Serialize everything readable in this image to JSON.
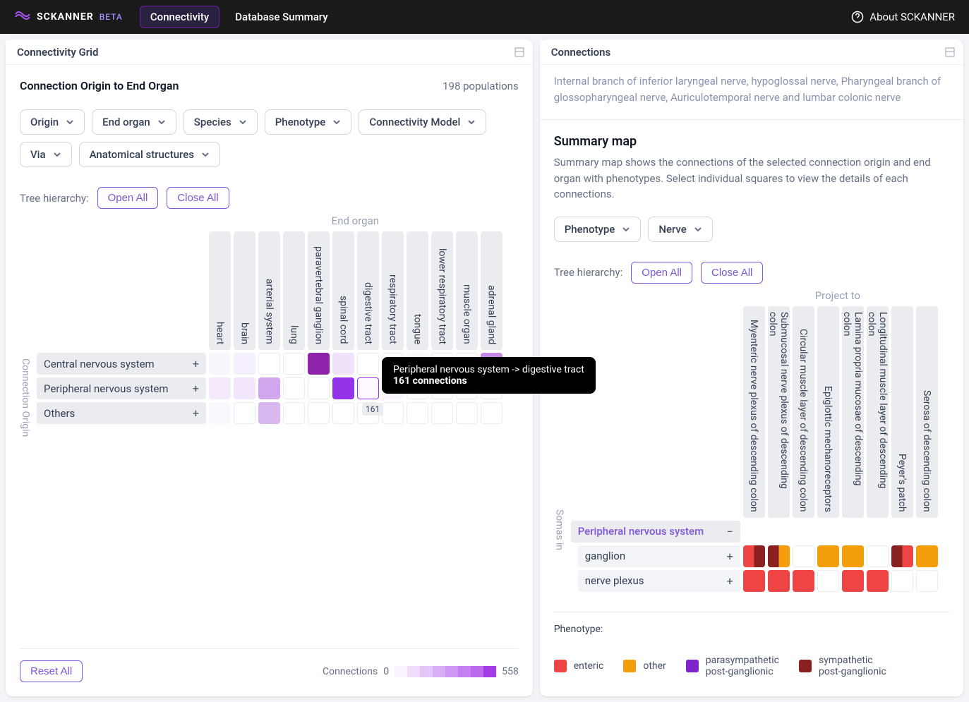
{
  "header": {
    "brand": "SCKANNER",
    "beta": "BETA",
    "nav": {
      "connectivity": "Connectivity",
      "db_summary": "Database Summary"
    },
    "about": "About SCKANNER"
  },
  "left_panel": {
    "tab": "Connectivity Grid",
    "subtitle": "Connection Origin to End Organ",
    "populations": "198 populations",
    "filters": {
      "origin": "Origin",
      "end_organ": "End organ",
      "species": "Species",
      "phenotype": "Phenotype",
      "connectivity_model": "Connectivity Model",
      "via": "Via",
      "anatomical": "Anatomical structures"
    },
    "tree_label": "Tree hierarchy:",
    "open_all": "Open All",
    "close_all": "Close All",
    "y_axis": "Connection Origin",
    "x_axis": "End organ",
    "columns": [
      "heart",
      "brain",
      "arterial system",
      "lung",
      "paravertebral ganglion",
      "spinal cord",
      "digestive tract",
      "respiratory tract",
      "tongue",
      "lower respiratory tract",
      "muscle organ",
      "adrenal gland"
    ],
    "rows": [
      {
        "label": "Central nervous system",
        "values": [
          "#f9f6fd",
          "#f6effd",
          "",
          "",
          "#8e24aa",
          "#efe2fa",
          "",
          "",
          "#fcf8fe",
          "",
          "",
          "#c589e8"
        ]
      },
      {
        "label": "Peripheral nervous system",
        "values": [
          "#f4eafb",
          "#f2e6fa",
          "#d1a6ec",
          "",
          "",
          "#9333ea",
          "hover",
          "#fbf5fe",
          "",
          "",
          "",
          ""
        ]
      },
      {
        "label": "Others",
        "values": [
          "#fbf7fe",
          "",
          "#d9b8f0",
          "",
          "",
          "",
          "",
          "",
          "",
          "",
          "",
          ""
        ]
      }
    ],
    "tooltip": {
      "title": "Peripheral nervous system -> digestive tract",
      "count_label": "161 connections",
      "badge": "161"
    },
    "footer": {
      "reset": "Reset All",
      "connections_label": "Connections",
      "min": "0",
      "max": "558"
    },
    "legend_colors": [
      "#f8f3fd",
      "#eedcfb",
      "#e3c5f8",
      "#d9aef5",
      "#cf97f2",
      "#c480ef",
      "#ba69ec",
      "#a33be6"
    ]
  },
  "right_panel": {
    "tab": "Connections",
    "breadcrumb": "Internal branch of inferior laryngeal nerve, hypoglossal nerve, Pharyngeal branch of glossopharyngeal nerve, Auriculotemporal nerve and lumbar colonic nerve",
    "summary_title": "Summary map",
    "summary_desc": "Summary map shows the connections of the selected connection origin and end organ with phenotypes. Select individual squares to view the details of each connections.",
    "filters": {
      "phenotype": "Phenotype",
      "nerve": "Nerve"
    },
    "tree_label": "Tree hierarchy:",
    "open_all": "Open All",
    "close_all": "Close All",
    "y_axis": "Somas in",
    "x_axis": "Project to",
    "columns": [
      "Myenteric nerve plexus of descending colon",
      "Submucosal nerve plexus of descending colon",
      "Circular muscle layer of descending colon",
      "Epiglottic mechanoreceptors",
      "Lamina propria mucosae of descending colon",
      "Longitudinal muscle layer of descending colon",
      "Peyer's patch",
      "Serosa of descending colon"
    ],
    "rows_parent": {
      "label": "Peripheral nervous system"
    },
    "rows": [
      {
        "label": "ganglion",
        "cells": [
          "split-red-brown",
          "split-brown-yellow",
          "",
          "#f59e0b",
          "#f59e0b",
          "",
          "split-brown-red",
          "#f59e0b"
        ]
      },
      {
        "label": "nerve plexus",
        "cells": [
          "#ef4444",
          "#ef4444",
          "#ef4444",
          "",
          "#ef4444",
          "#ef4444",
          "",
          ""
        ]
      }
    ],
    "pheno_legend_label": "Phenotype:",
    "pheno_legend": [
      {
        "color": "#ef4444",
        "label": "enteric"
      },
      {
        "color": "#f59e0b",
        "label": "other"
      },
      {
        "color": "#7e22ce",
        "label": "parasympathetic\npost-ganglionic"
      },
      {
        "color": "#8b2020",
        "label": "sympathetic\npost-ganglionic"
      }
    ]
  }
}
